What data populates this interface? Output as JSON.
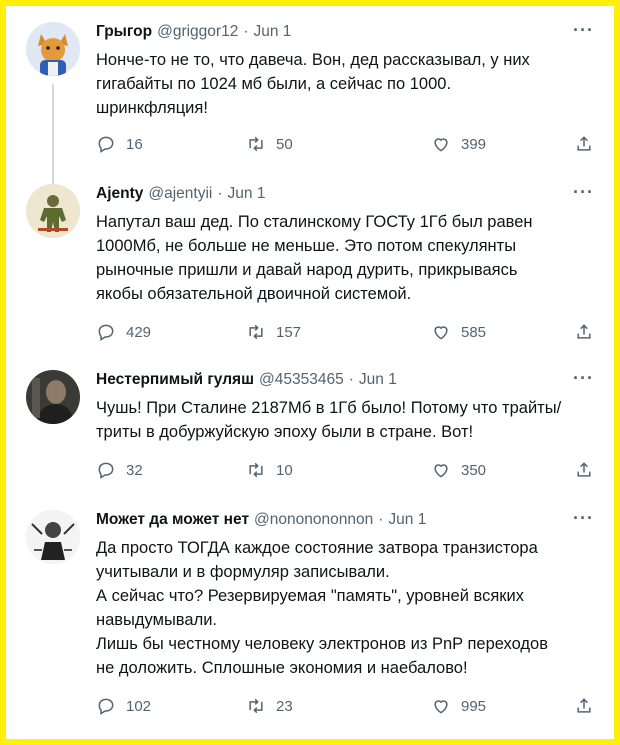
{
  "tweets": [
    {
      "name": "Грыгор",
      "handle": "@griggor12",
      "separator": "·",
      "date": "Jun 1",
      "text": "Нонче-то не то, что давеча. Вон, дед рассказывал, у них\nгигабайты по 1024 мб были, а сейчас по 1000.\nшринкфляция!",
      "replies": "16",
      "retweets": "50",
      "likes": "399"
    },
    {
      "name": "Ajenty",
      "handle": "@ajentyii",
      "separator": "·",
      "date": "Jun 1",
      "text": "Напутал ваш дед. По сталинскому ГОСТу 1Гб был равен\n1000Мб, не больше не меньше. Это потом спекулянты\nрыночные пришли и давай народ дурить, прикрываясь\nякобы обязательной двоичной системой.",
      "replies": "429",
      "retweets": "157",
      "likes": "585"
    },
    {
      "name": "Нестерпимый гуляш",
      "handle": "@45353465",
      "separator": "·",
      "date": "Jun 1",
      "text": "Чушь! При Сталине 2187Мб в 1Гб было! Потому что трайты/\nтриты в добуржуйскую эпоху были в стране. Вот!",
      "replies": "32",
      "retweets": "10",
      "likes": "350"
    },
    {
      "name": "Может да может нет",
      "handle": "@nononononnon",
      "separator": "·",
      "date": "Jun 1",
      "text": "Да просто ТОГДА каждое состояние затвора транзистора\nучитывали и в формуляр записывали.\nА сейчас что? Резервируемая \"память\", уровней всяких\nнавыдумывали.\nЛишь бы честному человеку электронов из PnP переходов\nне доложить. Сплошные экономия и наебалово!",
      "replies": "102",
      "retweets": "23",
      "likes": "995"
    }
  ],
  "more_label": "···",
  "icons": {
    "reply": "reply-icon",
    "retweet": "retweet-icon",
    "like": "heart-icon",
    "share": "share-icon"
  },
  "colors": {
    "frame": "#ffef0a",
    "text": "#0f1419",
    "muted": "#536471",
    "thread_line": "#cfd9de"
  }
}
